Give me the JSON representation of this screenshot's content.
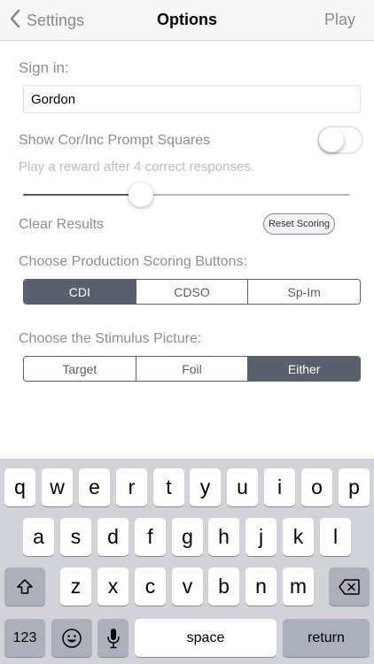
{
  "nav": {
    "back_label": "Settings",
    "title": "Options",
    "play_label": "Play"
  },
  "sign_in": {
    "label": "Sign in:",
    "value": "Gordon"
  },
  "prompt_squares": {
    "label": "Show Cor/Inc Prompt Squares",
    "enabled": false
  },
  "reward": {
    "label": "Play a reward after 4 correct responses.",
    "slider_fraction": 0.36
  },
  "clear_results": {
    "label": "Clear Results",
    "button_label": "Reset Scoring"
  },
  "production_scoring": {
    "label": "Choose Production Scoring Buttons:",
    "options": [
      "CDI",
      "CDSO",
      "Sp-Im"
    ],
    "selected": "CDI"
  },
  "stimulus_picture": {
    "label": "Choose the Stimulus Picture:",
    "options": [
      "Target",
      "Foil",
      "Either"
    ],
    "selected": "Either"
  },
  "keyboard": {
    "row1": [
      "q",
      "w",
      "e",
      "r",
      "t",
      "y",
      "u",
      "i",
      "o",
      "p"
    ],
    "row2": [
      "a",
      "s",
      "d",
      "f",
      "g",
      "h",
      "j",
      "k",
      "l"
    ],
    "row3": [
      "z",
      "x",
      "c",
      "v",
      "b",
      "n",
      "m"
    ],
    "numbers_label": "123",
    "space_label": "space",
    "return_label": "return"
  },
  "colors": {
    "accent": "#5a5f6c",
    "keyboard_bg": "#d1d3d9",
    "label_gray": "#8e8e93"
  }
}
